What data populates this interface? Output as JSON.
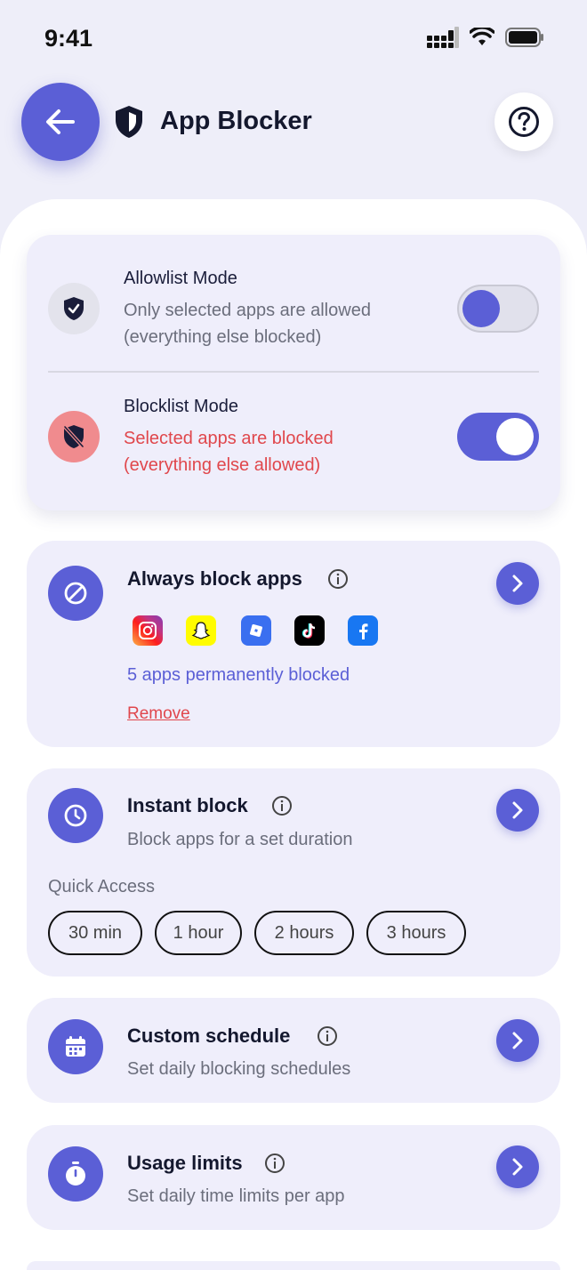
{
  "status_bar": {
    "time": "9:41"
  },
  "header": {
    "title": "App Blocker"
  },
  "modes": {
    "allowlist": {
      "title": "Allowlist Mode",
      "desc_line1": "Only selected apps are allowed",
      "desc_line2": "(everything else blocked)",
      "enabled": false
    },
    "blocklist": {
      "title": "Blocklist Mode",
      "desc_line1": "Selected apps are blocked",
      "desc_line2": "(everything else allowed)",
      "enabled": true
    }
  },
  "always_block": {
    "title": "Always block apps",
    "apps": [
      "instagram",
      "snapchat",
      "roblox",
      "tiktok",
      "facebook"
    ],
    "count_text": "5 apps permanently blocked",
    "remove_label": "Remove"
  },
  "instant_block": {
    "title": "Instant block",
    "subtitle": "Block apps for a set duration",
    "quick_access_label": "Quick Access",
    "chips": [
      "30 min",
      "1 hour",
      "2 hours",
      "3 hours"
    ]
  },
  "custom_schedule": {
    "title": "Custom schedule",
    "subtitle": "Set daily blocking schedules"
  },
  "usage_limits": {
    "title": "Usage limits",
    "subtitle": "Set daily time limits per app"
  },
  "colors": {
    "accent": "#5b5fd6",
    "danger": "#e0474c",
    "card_bg": "#efeefb",
    "page_bg": "#eeeef9"
  }
}
